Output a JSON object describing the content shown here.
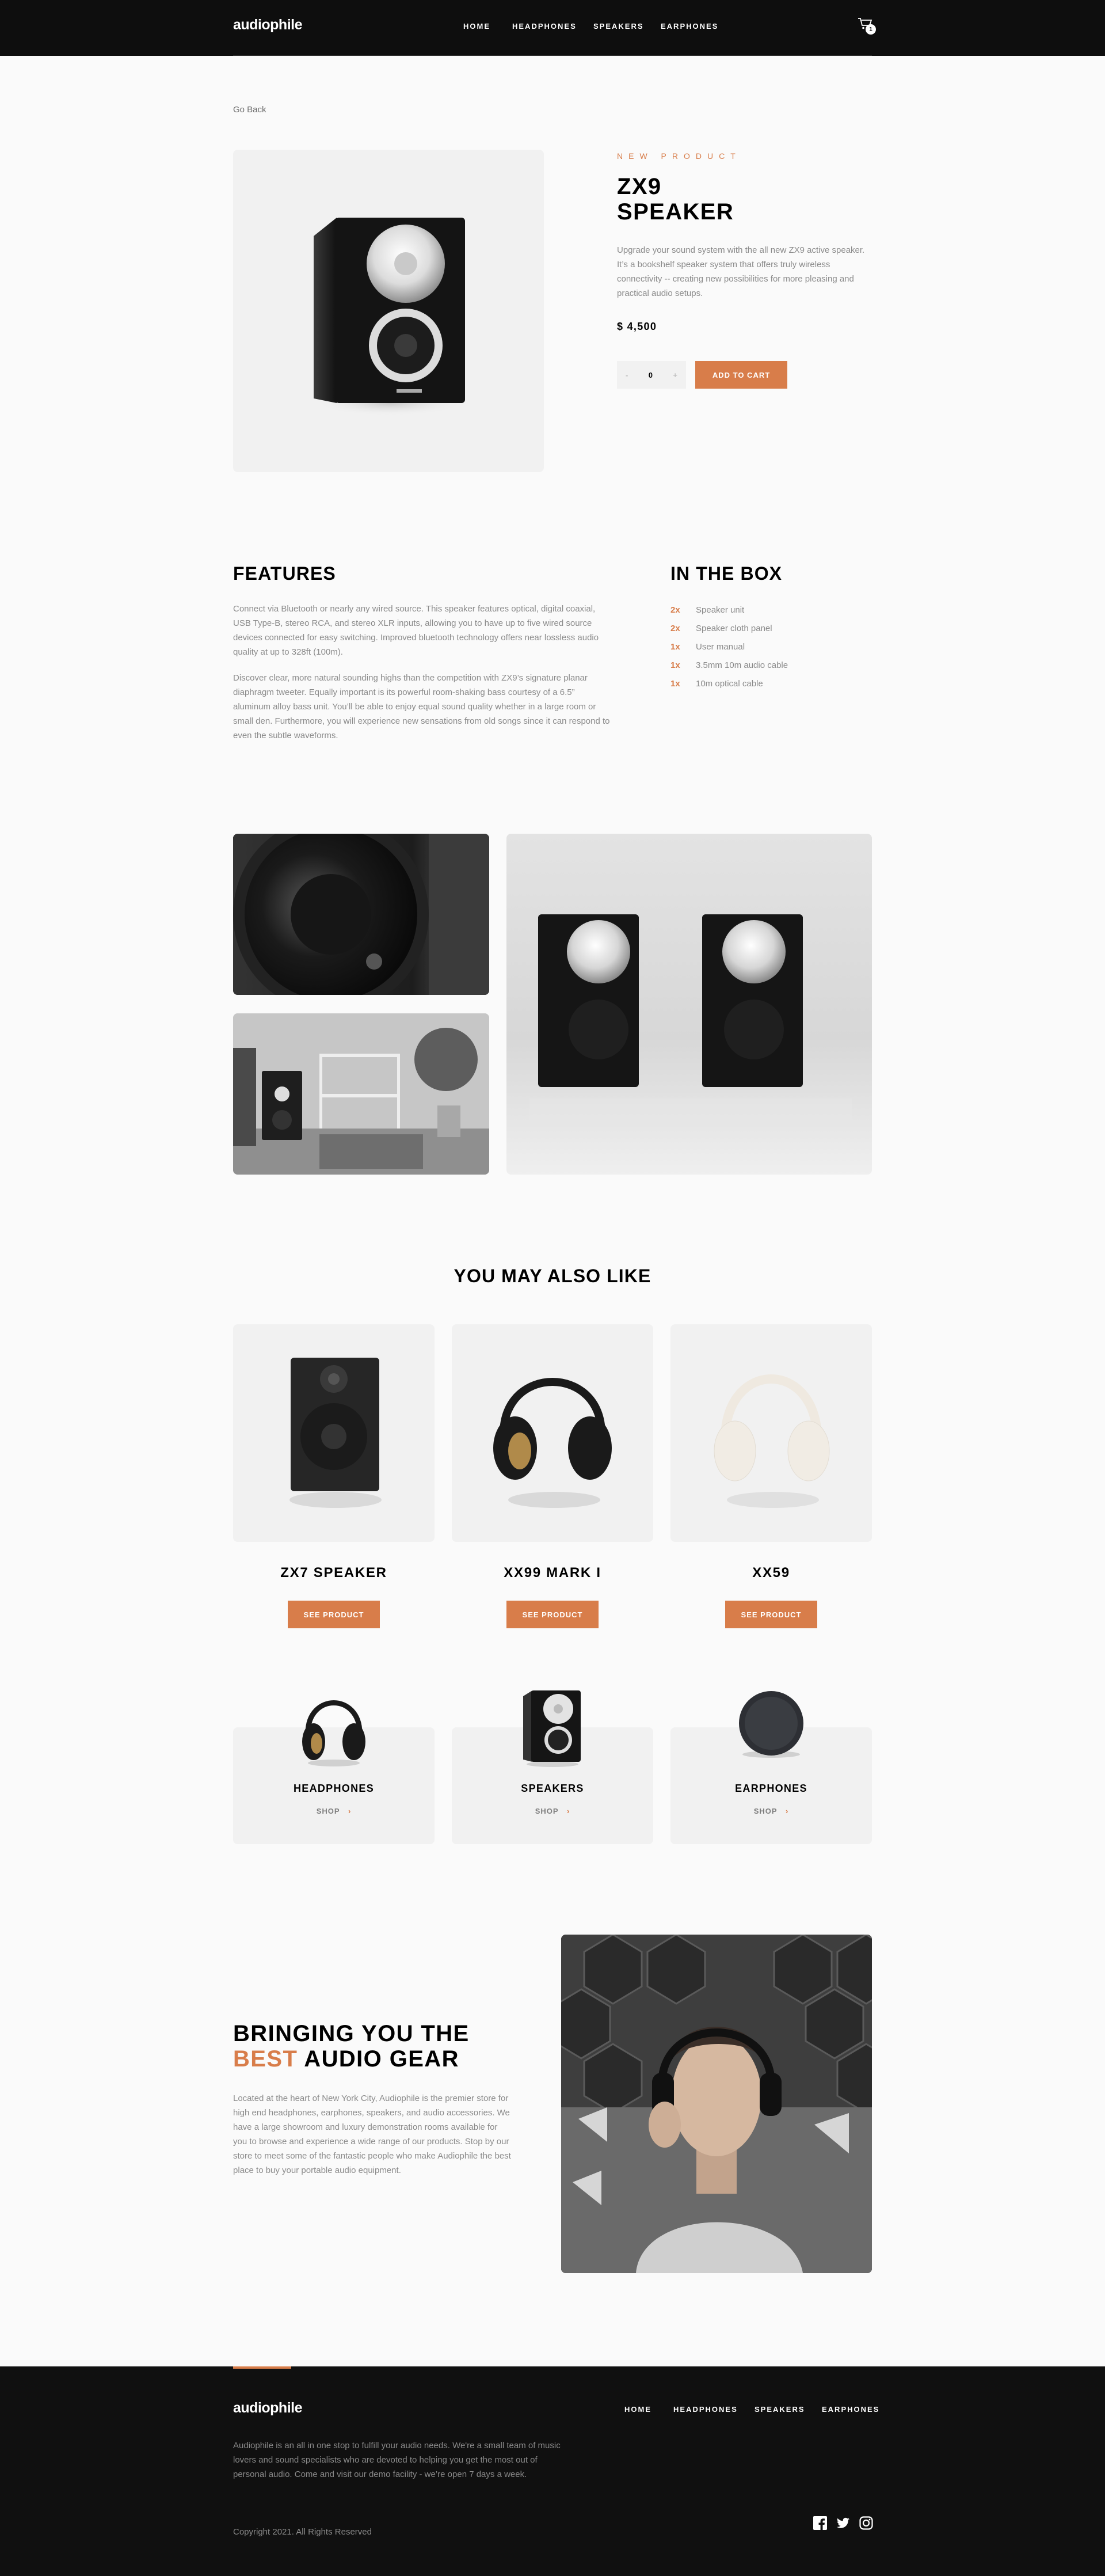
{
  "header": {
    "logo": "audiophile",
    "nav": [
      "HOME",
      "HEADPHONES",
      "SPEAKERS",
      "EARPHONES"
    ],
    "cart_count": "1"
  },
  "go_back": "Go Back",
  "product": {
    "overline": "NEW PRODUCT",
    "title_line1": "ZX9",
    "title_line2": "SPEAKER",
    "description": "Upgrade your sound system with the all new ZX9 active speaker. It’s a bookshelf speaker system that offers truly wireless connectivity -- creating new possibilities for more pleasing and practical audio setups.",
    "price": "$ 4,500",
    "quantity": "0",
    "minus": "-",
    "plus": "+",
    "add_to_cart": "ADD TO CART"
  },
  "features": {
    "title": "FEATURES",
    "paragraph1": "Connect via Bluetooth or nearly any wired source. This speaker features optical, digital coaxial, USB Type-B, stereo RCA, and stereo XLR inputs, allowing you to have up to five wired source devices connected for easy switching. Improved bluetooth technology offers near lossless audio quality at up to 328ft (100m).",
    "paragraph2": "Discover clear, more natural sounding highs than the competition with ZX9’s signature planar diaphragm tweeter. Equally important is its powerful room-shaking bass courtesy of a 6.5” aluminum alloy bass unit. You’ll be able to enjoy equal sound quality whether in a large room or small den. Furthermore, you will experience new sensations from old songs since it can respond to even the subtle waveforms."
  },
  "in_the_box": {
    "title": "IN THE BOX",
    "items": [
      {
        "qty": "2x",
        "name": "Speaker unit"
      },
      {
        "qty": "2x",
        "name": "Speaker cloth panel"
      },
      {
        "qty": "1x",
        "name": "User manual"
      },
      {
        "qty": "1x",
        "name": "3.5mm 10m audio cable"
      },
      {
        "qty": "1x",
        "name": "10m optical cable"
      }
    ]
  },
  "also_like": {
    "title": "YOU MAY ALSO LIKE",
    "items": [
      {
        "name": "ZX7 SPEAKER",
        "button": "SEE PRODUCT"
      },
      {
        "name": "XX99 MARK I",
        "button": "SEE PRODUCT"
      },
      {
        "name": "XX59",
        "button": "SEE PRODUCT"
      }
    ]
  },
  "categories": [
    {
      "name": "HEADPHONES",
      "shop": "SHOP"
    },
    {
      "name": "SPEAKERS",
      "shop": "SHOP"
    },
    {
      "name": "EARPHONES",
      "shop": "SHOP"
    }
  ],
  "about": {
    "title_line1": "BRINGING YOU THE",
    "title_accent": "BEST",
    "title_rest": " AUDIO GEAR",
    "text": "Located at the heart of New York City, Audiophile is the premier store for high end headphones, earphones, speakers, and audio accessories. We have a large showroom and luxury demonstration rooms available for you to browse and experience a wide range of our products. Stop by our store to meet some of the fantastic people who make Audiophile the best place to buy your portable audio equipment."
  },
  "footer": {
    "logo": "audiophile",
    "nav": [
      "HOME",
      "HEADPHONES",
      "SPEAKERS",
      "EARPHONES"
    ],
    "text": "Audiophile is an all in one stop to fulfill your audio needs. We're a small team of music lovers and sound specialists who are devoted to helping you get the most out of personal audio. Come and visit our demo facility - we’re open 7 days a week.",
    "copyright": "Copyright 2021. All Rights Reserved",
    "social": [
      "facebook-icon",
      "twitter-icon",
      "instagram-icon"
    ]
  },
  "colors": {
    "accent": "#d87d4a",
    "dark": "#101010",
    "light_bg": "#f1f1f1"
  }
}
